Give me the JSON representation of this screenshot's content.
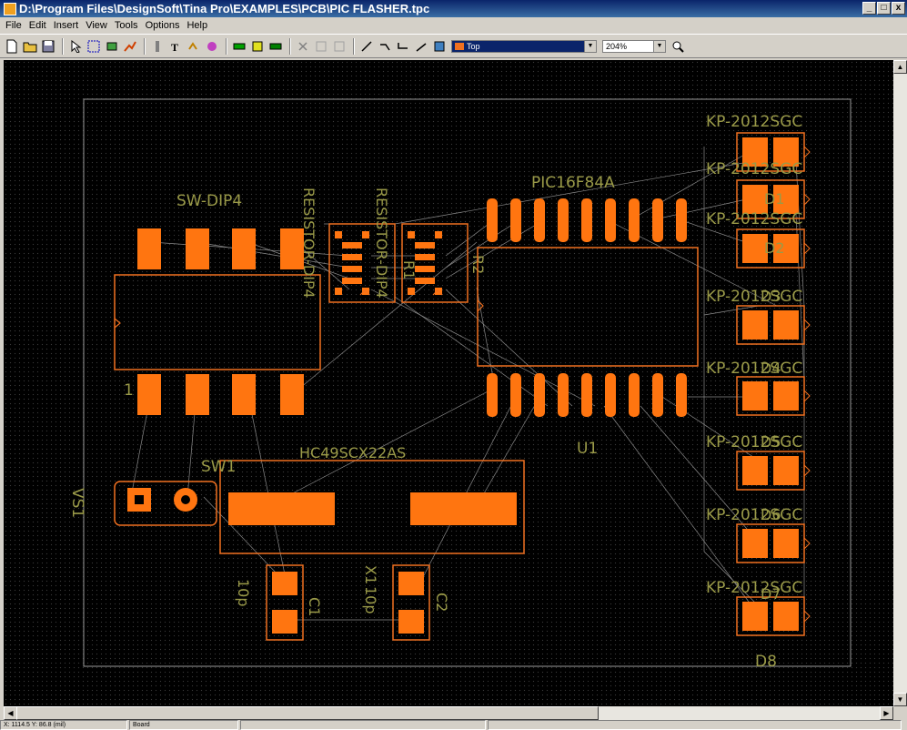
{
  "window": {
    "title": "D:\\Program Files\\DesignSoft\\Tina Pro\\EXAMPLES\\PCB\\PIC FLASHER.tpc",
    "controls": [
      "_",
      "□",
      "x"
    ]
  },
  "menu": [
    "File",
    "Edit",
    "Insert",
    "View",
    "Tools",
    "Options",
    "Help"
  ],
  "toolbar": {
    "layer": "Top",
    "zoom": "204%",
    "icons": [
      "new-file-icon",
      "open-folder-icon",
      "save-icon",
      "pointer-icon",
      "select-icon",
      "component-icon",
      "autoroute-icon",
      "track-icon",
      "text-icon",
      "dimension-icon",
      "drill-icon",
      "layer-green-icon",
      "layer-yellow-icon",
      "layer-green2-icon",
      "delete-icon",
      "undo-icon",
      "redo-icon",
      "line-icon",
      "arc-right-icon",
      "arc-left-icon",
      "arc-icon",
      "fill-icon",
      "zoom-icon"
    ]
  },
  "pcb": {
    "colors": {
      "pad": "#ff7510",
      "outline": "#f07020",
      "silk": "#8a8a40",
      "ratsnest": "#9a9a9a",
      "board": "#9a9a9a"
    },
    "labels": {
      "sw_dip4": "SW-DIP4",
      "resistor_dip4_a": "RESISTOR-DIP4",
      "resistor_dip4_b": "RESISTOR-DIP4",
      "r1": "R1",
      "r2": "R2",
      "pic": "PIC16F84A",
      "u1": "U1",
      "pin1": "1",
      "sw1": "SW1",
      "hc49": "HC49SCX22AS",
      "vs1": "VS1",
      "x1": "X1",
      "c1": "C1",
      "c2": "C2",
      "c1_value": "10p",
      "c2_value": "10p",
      "kp": "KP-2012SGC",
      "d1": "D1",
      "d2": "D2",
      "d3": "D3",
      "d4": "D4",
      "d5": "D5",
      "d6": "D6",
      "d7": "D7",
      "d8": "D8"
    }
  },
  "status": {
    "coords": "X: 1114.5  Y:  86.8  (mil)",
    "layer": "Board",
    "panel3": "",
    "panel4": ""
  }
}
